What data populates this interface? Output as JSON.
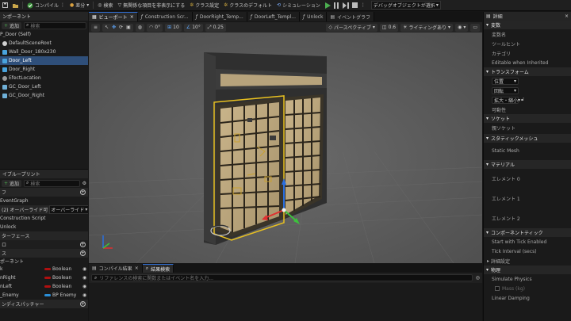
{
  "toolbar": {
    "compile": "コンパイル",
    "diff": "差分",
    "search": "検索",
    "hide_unrelated": "無関係な項目を非表示にする",
    "class_settings": "クラス設定",
    "class_defaults": "クラスのデフォルト",
    "simulation": "シミュレーション",
    "debug_object": "デバッグオブジェクトが選択されていません"
  },
  "components": {
    "title": "ンポーネント",
    "add": "追加",
    "search_placeholder": "検索",
    "items": [
      {
        "label": "P_Door (Self)",
        "selected": false
      },
      {
        "label": "DefaultSceneRoot",
        "selected": false
      },
      {
        "label": "Wall_Door_180x230",
        "selected": false
      },
      {
        "label": "Door_Left",
        "selected": true
      },
      {
        "label": "Door_Right",
        "selected": false
      },
      {
        "label": "EfectLocation",
        "selected": false
      },
      {
        "label": "GC_Door_Left",
        "selected": false
      },
      {
        "label": "GC_Door_Right",
        "selected": false
      }
    ]
  },
  "blueprint": {
    "title": "イブループリント",
    "add": "追加",
    "search_placeholder": "検索",
    "graphs_head": "フ",
    "event_graph": "EventGraph",
    "functions_head": "(2) オーバーライド可",
    "override_label": "オーバーライド",
    "functions": [
      "Construction Script",
      "Unlock"
    ],
    "interfaces_head": "ターフェース",
    "macros_head": "ロ",
    "variables_head": "ス",
    "components_head": "ポーネント",
    "variables": [
      {
        "name": "k",
        "type": "Boolean",
        "color": "#b01010"
      },
      {
        "name": "nRight",
        "type": "Boolean",
        "color": "#b01010"
      },
      {
        "name": "nLeft",
        "type": "Boolean",
        "color": "#b01010"
      },
      {
        "name": "_Enemy",
        "type": "BP Enemy",
        "color": "#2a8fd8"
      }
    ],
    "dispatchers_head": "ンディスパッチャー"
  },
  "tabs": [
    {
      "label": "ビューポート",
      "active": true
    },
    {
      "label": "Construction Scr...",
      "active": false
    },
    {
      "label": "DoorRight_Temp...",
      "active": false
    },
    {
      "label": "DoorLeft_Templ...",
      "active": false
    },
    {
      "label": "Unlock",
      "active": false
    },
    {
      "label": "イベントグラフ",
      "active": false
    }
  ],
  "viewport_bar": {
    "deg": "0°",
    "snap": "10",
    "rot": "10°",
    "scale": "0.25",
    "perspective": "パースペクティブ",
    "speed": "0.6",
    "lighting": "ライティングあり"
  },
  "results": {
    "tab_compile": "コンパイル結果",
    "tab_search": "結果検索",
    "search_placeholder": "リファレンスの検索に関数またはイベント名を入力..."
  },
  "details": {
    "title": "詳細",
    "variables": "変数",
    "var_name": "変数名",
    "tooltip": "ツールヒント",
    "category": "カテゴリ",
    "editable": "Editable when Inherited",
    "transform": "トランスフォーム",
    "location": "位置",
    "rotation": "回転",
    "scale": "拡大・縮小",
    "mobility": "可動性",
    "socket": "ソケット",
    "parent_socket": "親ソケット",
    "static_mesh_head": "スタティックメッシュ",
    "static_mesh": "Static Mesh",
    "materials": "マテリアル",
    "element0": "エレメント 0",
    "element1": "エレメント 1",
    "element2": "エレメント 2",
    "component_tick": "コンポーネントティック",
    "start_tick": "Start with Tick Enabled",
    "tick_interval": "Tick Interval (secs)",
    "advanced": "詳細設定",
    "physics": "物理",
    "simulate": "Simulate Physics",
    "mass": "Mass (kg)",
    "linear_damping": "Linear Damping"
  },
  "colors": {
    "accent": "#2f6fd6",
    "selection": "#2f4f7a",
    "play": "#4caf50",
    "gizmo_x": "#e03030",
    "gizmo_y": "#3cc23c",
    "gizmo_z": "#2a6fe0",
    "door_outline": "#e8c020"
  }
}
